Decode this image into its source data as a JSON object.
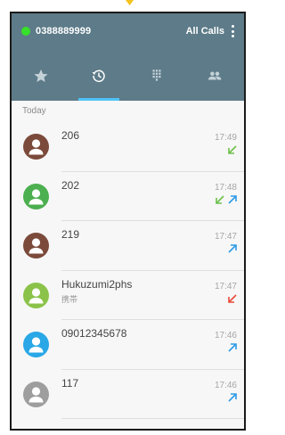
{
  "header": {
    "sim_number": "0388889999",
    "filter_label": "All Calls",
    "colors": {
      "bar": "#5d7b88",
      "sim_dot": "#37e02a",
      "tab_indicator": "#4fc3f7"
    }
  },
  "tabs": [
    {
      "icon": "star-icon",
      "active": false
    },
    {
      "icon": "recents-clock-icon",
      "active": true
    },
    {
      "icon": "dialpad-icon",
      "active": false
    },
    {
      "icon": "contacts-icon",
      "active": false
    }
  ],
  "section": {
    "label": "Today"
  },
  "calls": [
    {
      "name": "206",
      "sub": "",
      "time": "17:49",
      "avatar_color": "#7b4a3a",
      "directions": [
        "incoming"
      ]
    },
    {
      "name": "202",
      "sub": "",
      "time": "17:48",
      "avatar_color": "#4caf50",
      "directions": [
        "incoming",
        "outgoing"
      ]
    },
    {
      "name": "219",
      "sub": "",
      "time": "17:47",
      "avatar_color": "#7b4a3a",
      "directions": [
        "outgoing"
      ]
    },
    {
      "name": "Hukuzumi2phs",
      "sub": "携帯",
      "time": "17:47",
      "avatar_color": "#8bc34a",
      "directions": [
        "missed"
      ]
    },
    {
      "name": "09012345678",
      "sub": "",
      "time": "17:46",
      "avatar_color": "#29a7e6",
      "directions": [
        "outgoing"
      ]
    },
    {
      "name": "117",
      "sub": "",
      "time": "17:46",
      "avatar_color": "#9e9e9e",
      "directions": [
        "outgoing"
      ]
    }
  ],
  "direction_colors": {
    "incoming": "#6cc04a",
    "outgoing": "#2e9be6",
    "missed": "#e84a3a"
  }
}
